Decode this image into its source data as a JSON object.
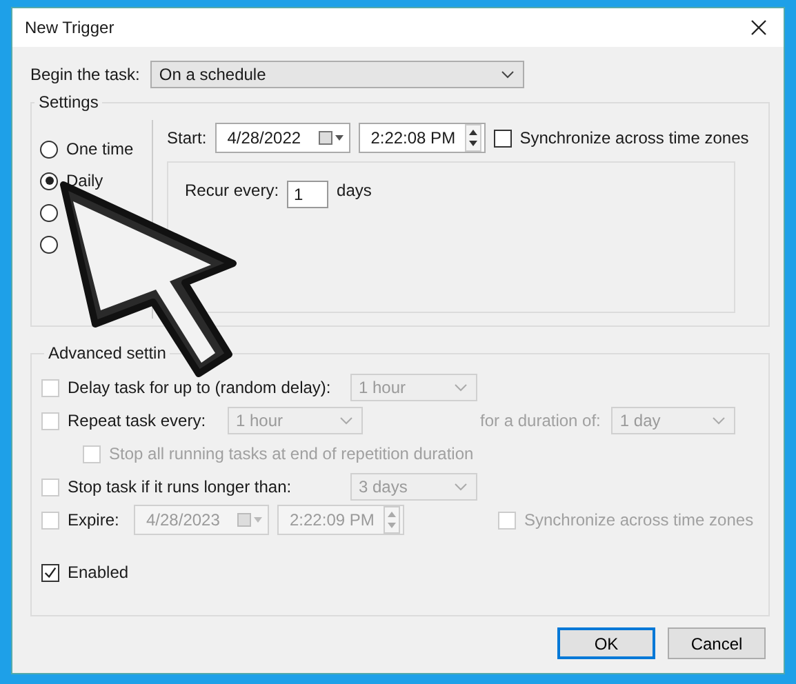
{
  "window": {
    "title": "New Trigger"
  },
  "begin_task": {
    "label": "Begin the task:",
    "value": "On a schedule"
  },
  "settings": {
    "title": "Settings",
    "schedule_options": [
      {
        "label": "One time",
        "selected": false
      },
      {
        "label": "Daily",
        "selected": true
      },
      {
        "selected": false
      },
      {
        "selected": false
      }
    ],
    "start": {
      "label": "Start:",
      "date": "4/28/2022",
      "time": "2:22:08 PM",
      "sync": {
        "label": "Synchronize across time zones",
        "checked": false
      }
    },
    "recur": {
      "label": "Recur every:",
      "value": "1",
      "unit": "days"
    }
  },
  "advanced": {
    "title": "Advanced settin",
    "delay": {
      "label": "Delay task for up to (random delay):",
      "checked": false,
      "value": "1 hour",
      "disabled": true
    },
    "repeat": {
      "label": "Repeat task every:",
      "checked": false,
      "value": "1 hour",
      "disabled": true,
      "duration_label": "for a duration of:",
      "duration_value": "1 day"
    },
    "stop_all": {
      "label": "Stop all running tasks at end of repetition duration",
      "checked": false,
      "disabled": true
    },
    "stop_long": {
      "label": "Stop task if it runs longer than:",
      "checked": false,
      "value": "3 days",
      "disabled": true
    },
    "expire": {
      "label": "Expire:",
      "checked": false,
      "date": "4/28/2023",
      "time": "2:22:09 PM",
      "disabled": true,
      "sync": {
        "label": "Synchronize across time zones",
        "checked": false,
        "disabled": true
      }
    },
    "enabled": {
      "label": "Enabled",
      "checked": true
    }
  },
  "buttons": [
    {
      "label": "OK",
      "default": true
    },
    {
      "label": "Cancel",
      "default": false
    }
  ]
}
